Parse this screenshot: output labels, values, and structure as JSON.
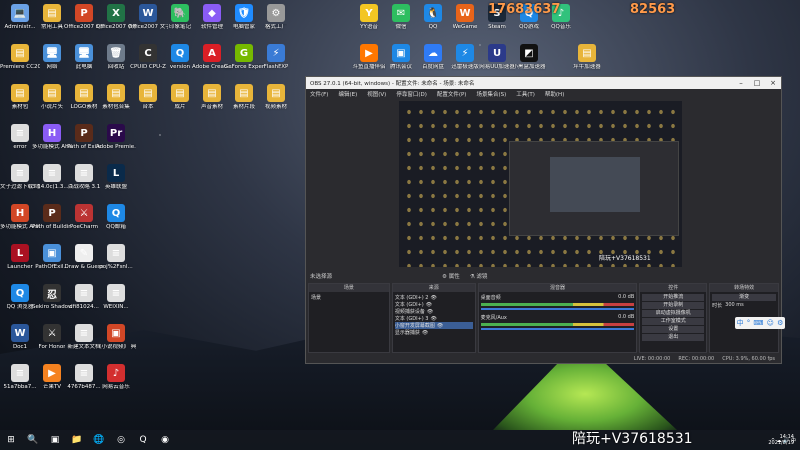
{
  "desktop": {
    "icons": [
      {
        "label": "Administr...",
        "glyph": "💻",
        "color": "#6aa1e6"
      },
      {
        "label": "常用工具",
        "glyph": "▤",
        "color": "#e8b53a"
      },
      {
        "label": "Office2007 幻灯片PPT",
        "glyph": "P",
        "color": "#d24726"
      },
      {
        "label": "Office2007 表格",
        "glyph": "X",
        "color": "#217346"
      },
      {
        "label": "Office2007 文字",
        "glyph": "W",
        "color": "#2b579a"
      },
      {
        "label": "印象笔记",
        "glyph": "🐘",
        "color": "#2dbe60"
      },
      {
        "label": "软件管理",
        "glyph": "◆",
        "color": "#8a5cf5"
      },
      {
        "label": "电脑管家",
        "glyph": "🛡",
        "color": "#1f8bff"
      },
      {
        "label": "格式工厂",
        "glyph": "⚙",
        "color": "#999"
      },
      {
        "label": "Premiere CC2019",
        "glyph": "▤",
        "color": "#e8b53a"
      },
      {
        "label": "网络",
        "glyph": "🖥",
        "color": "#4a90d9"
      },
      {
        "label": "此电脑",
        "glyph": "🖥",
        "color": "#4a90d9"
      },
      {
        "label": "回收站",
        "glyph": "🗑",
        "color": "#6e7b8b"
      },
      {
        "label": "CPUID CPU-Z",
        "glyph": "C",
        "color": "#333"
      },
      {
        "label": "version",
        "glyph": "Q",
        "color": "#1e88e5"
      },
      {
        "label": "Adobe Creati...",
        "glyph": "A",
        "color": "#da1f26"
      },
      {
        "label": "GeForce Experience",
        "glyph": "G",
        "color": "#76b900"
      },
      {
        "label": "FlashFXP",
        "glyph": "⚡",
        "color": "#3a7bd5"
      },
      {
        "label": "素材包",
        "glyph": "▤",
        "color": "#e8b53a"
      },
      {
        "label": "小说片头",
        "glyph": "▤",
        "color": "#e8b53a"
      },
      {
        "label": "LOGO素材",
        "glyph": "▤",
        "color": "#e8b53a"
      },
      {
        "label": "素材包合集",
        "glyph": "▤",
        "color": "#e8b53a"
      },
      {
        "label": "台本",
        "glyph": "▤",
        "color": "#e8b53a"
      },
      {
        "label": "成片",
        "glyph": "▤",
        "color": "#e8b53a"
      },
      {
        "label": "声音素材",
        "glyph": "▤",
        "color": "#e8b53a"
      },
      {
        "label": "素材片段",
        "glyph": "▤",
        "color": "#e8b53a"
      },
      {
        "label": "视频素材",
        "glyph": "▤",
        "color": "#e8b53a"
      },
      {
        "label": "error",
        "glyph": "≡",
        "color": "#ddd"
      },
      {
        "label": "多功能模式 AHK",
        "glyph": "H",
        "color": "#8a5cf5"
      },
      {
        "label": "Path of Exile",
        "glyph": "P",
        "color": "#5a2b1a"
      },
      {
        "label": "Adobe Premie...",
        "glyph": "Pr",
        "color": "#2a0a4a"
      },
      {
        "label": "文子过滤下载 地址",
        "glyph": "≡",
        "color": "#ddd"
      },
      {
        "label": "3.14.0c(1.3... 规则优化...",
        "glyph": "≡",
        "color": "#ddd"
      },
      {
        "label": "百战攻略 3.1",
        "glyph": "≡",
        "color": "#ddd"
      },
      {
        "label": "英雄联盟",
        "glyph": "L",
        "color": "#0a2a4a"
      },
      {
        "label": "多功能模式 AHK20.19...",
        "glyph": "H",
        "color": "#d24726"
      },
      {
        "label": "Path of Building",
        "glyph": "P",
        "color": "#5a2b1a"
      },
      {
        "label": "PoeCharm",
        "glyph": "⚔",
        "color": "#b33"
      },
      {
        "label": "QQ邮箱",
        "glyph": "Q",
        "color": "#1e88e5"
      },
      {
        "label": "Launcher",
        "glyph": "L",
        "color": "#a12"
      },
      {
        "label": "PathOfExil...",
        "glyph": "▣",
        "color": "#4a90d9"
      },
      {
        "label": "Draw & Guess",
        "glyph": "✎",
        "color": "#eee"
      },
      {
        "label": "poj%2Fsnl...",
        "glyph": "≡",
        "color": "#ddd"
      },
      {
        "label": "QQ 浏览器",
        "glyph": "Q",
        "color": "#1e88e5"
      },
      {
        "label": "Sekiro Shadows...",
        "glyph": "忍",
        "color": "#333"
      },
      {
        "label": "dfi81024...",
        "glyph": "≡",
        "color": "#ddd"
      },
      {
        "label": "WEIXIN...",
        "glyph": "≡",
        "color": "#ddd"
      },
      {
        "label": "Doc1",
        "glyph": "W",
        "color": "#2b579a"
      },
      {
        "label": "For Honor",
        "glyph": "⚔",
        "color": "#333"
      },
      {
        "label": "新建文本文档",
        "glyph": "≡",
        "color": "#ddd"
      },
      {
        "label": "《小说视频》 典藏图册...",
        "glyph": "▣",
        "color": "#d24726"
      },
      {
        "label": "51a7bba7...",
        "glyph": "≡",
        "color": "#ddd"
      },
      {
        "label": "芒果TV",
        "glyph": "▶",
        "color": "#f58220"
      },
      {
        "label": "4767b487...",
        "glyph": "≡",
        "color": "#ddd"
      },
      {
        "label": "网易云音乐",
        "glyph": "♪",
        "color": "#d32f2f"
      },
      {
        "label": "YY语音",
        "glyph": "Y",
        "color": "#f3c623"
      },
      {
        "label": "微信",
        "glyph": "✉",
        "color": "#2dbe60"
      },
      {
        "label": "QQ",
        "glyph": "🐧",
        "color": "#1e88e5"
      },
      {
        "label": "WeGame",
        "glyph": "W",
        "color": "#e8641a"
      },
      {
        "label": "Steam",
        "glyph": "S",
        "color": "#1b2838"
      },
      {
        "label": "QQ游戏",
        "glyph": "Q",
        "color": "#1e88e5"
      },
      {
        "label": "QQ音乐",
        "glyph": "♪",
        "color": "#31c27c"
      },
      {
        "label": "斗鱼直播伴侣",
        "glyph": "▶",
        "color": "#f70"
      },
      {
        "label": "腾讯会议",
        "glyph": "▣",
        "color": "#1e88e5"
      },
      {
        "label": "百度网盘",
        "glyph": "☁",
        "color": "#2f7bf5"
      },
      {
        "label": "迅雷极速版",
        "glyph": "⚡",
        "color": "#1e88e5"
      },
      {
        "label": "网易UU加速器",
        "glyph": "U",
        "color": "#2b3a8a"
      },
      {
        "label": "小黑盒加速器",
        "glyph": "◩",
        "color": "#111"
      },
      {
        "label": "坪牛加速器",
        "glyph": "▤",
        "color": "#e8b53a"
      }
    ]
  },
  "watermarks": {
    "top_left": "17683637",
    "top_right": "82563"
  },
  "obs": {
    "title": "OBS 27.0.1 (64-bit, windows) - 配置文件: 未命名 - 场景: 未命名",
    "menu": [
      "文件(F)",
      "编辑(E)",
      "视图(V)",
      "停靠窗口(D)",
      "配置文件(P)",
      "场景集合(S)",
      "工具(T)",
      "帮助(H)"
    ],
    "scene_bar": {
      "label": "未选择源",
      "props": "⚙ 属性",
      "filters": "⚗ 滤镜"
    },
    "docks": {
      "scenes": {
        "title": "场景",
        "items": [
          "场景"
        ]
      },
      "sources": {
        "title": "来源",
        "items": [
          "文本 (GDI+) 2",
          "文本 (GDI+)",
          "视频捕获设备",
          "文本 (GDI+) 3",
          "小窗开发屏幕截图",
          "显示器捕获"
        ]
      },
      "mixer": {
        "title": "混音器",
        "tracks": [
          {
            "name": "桌面音频",
            "db": "0.0 dB"
          },
          {
            "name": "麦克风/Aux",
            "db": "0.0 dB"
          }
        ]
      },
      "transitions": {
        "title": "转场特效",
        "type": "渐变",
        "duration_label": "时长",
        "duration": "300 ms"
      },
      "controls": {
        "title": "控件",
        "buttons": [
          "开始推流",
          "开始录制",
          "启动虚拟摄像机",
          "工作室模式",
          "设置",
          "退出"
        ]
      }
    },
    "status": {
      "live": "LIVE: 00:00:00",
      "rec": "REC: 00:00:00",
      "cpu": "CPU: 3.9%, 60.00 fps"
    },
    "preview_watermark": "陪玩+V37618531"
  },
  "float_bar": {
    "items": [
      "中",
      "°",
      "⌨",
      "☺",
      "⚙"
    ]
  },
  "taskbar": {
    "icons": [
      "⊞",
      "🔍",
      "▣",
      "📁",
      "🌐",
      "◎",
      "Q",
      "◉"
    ],
    "tray": "^ ☁ 🔊 中"
  },
  "caption": "陪玩+V37618531",
  "clock": {
    "time": "14:14",
    "date": "2021/8/19"
  }
}
